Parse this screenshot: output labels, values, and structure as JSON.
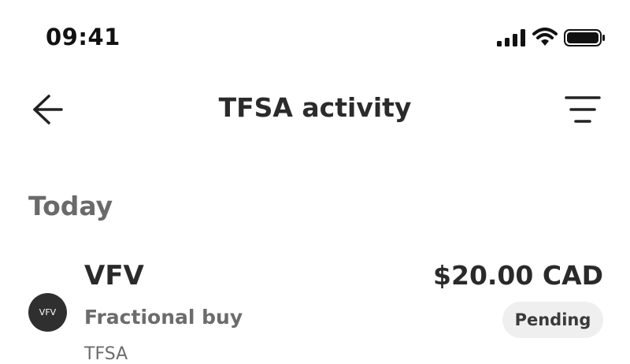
{
  "status_bar": {
    "time": "09:41",
    "icons": [
      "cellular-signal-icon",
      "wifi-icon",
      "battery-icon"
    ]
  },
  "header": {
    "title": "TFSA activity",
    "back_icon": "arrow-left-icon",
    "filter_icon": "filter-lines-icon"
  },
  "sections": [
    {
      "label": "Today",
      "items": [
        {
          "avatar_text": "VFV",
          "symbol": "VFV",
          "type": "Fractional buy",
          "account": "TFSA",
          "amount": "$20.00 CAD",
          "status": "Pending"
        }
      ]
    }
  ],
  "colors": {
    "background": "#ffffff",
    "text_primary": "#2a2a2a",
    "text_secondary": "#6c6c6c",
    "avatar_bg": "#2f2f2f",
    "badge_bg": "#efefef"
  }
}
